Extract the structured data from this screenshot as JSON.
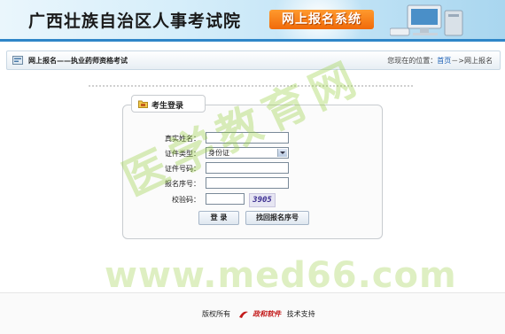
{
  "header": {
    "site_title": "广西壮族自治区人事考试院",
    "system_title": "网上报名系统"
  },
  "breadcrumb": {
    "title": "网上报名——执业药师资格考试",
    "location_prefix": "您现在的位置：",
    "home_link": "首页",
    "separator": "－>",
    "current": "网上报名"
  },
  "login": {
    "panel_title": "考生登录",
    "fields": {
      "name_label": "真实姓名：",
      "name_value": "",
      "idtype_label": "证件类型：",
      "idtype_value": "身份证",
      "idnumber_label": "证件号码：",
      "idnumber_value": "",
      "regno_label": "报名序号：",
      "regno_value": "",
      "captcha_label": "校验码：",
      "captcha_value": "",
      "captcha_image_text": "3905"
    },
    "buttons": {
      "login": "登 录",
      "retrieve": "找回报名序号"
    }
  },
  "watermark": {
    "cn": "医学教育网",
    "url": "www.med66.com"
  },
  "footer": {
    "copyright": "版权所有",
    "company": "政和软件",
    "support": "技术支持"
  },
  "colors": {
    "accent": "#2f86c8",
    "system_title_bg": "#f06a0a",
    "link": "#1a5fb4"
  }
}
